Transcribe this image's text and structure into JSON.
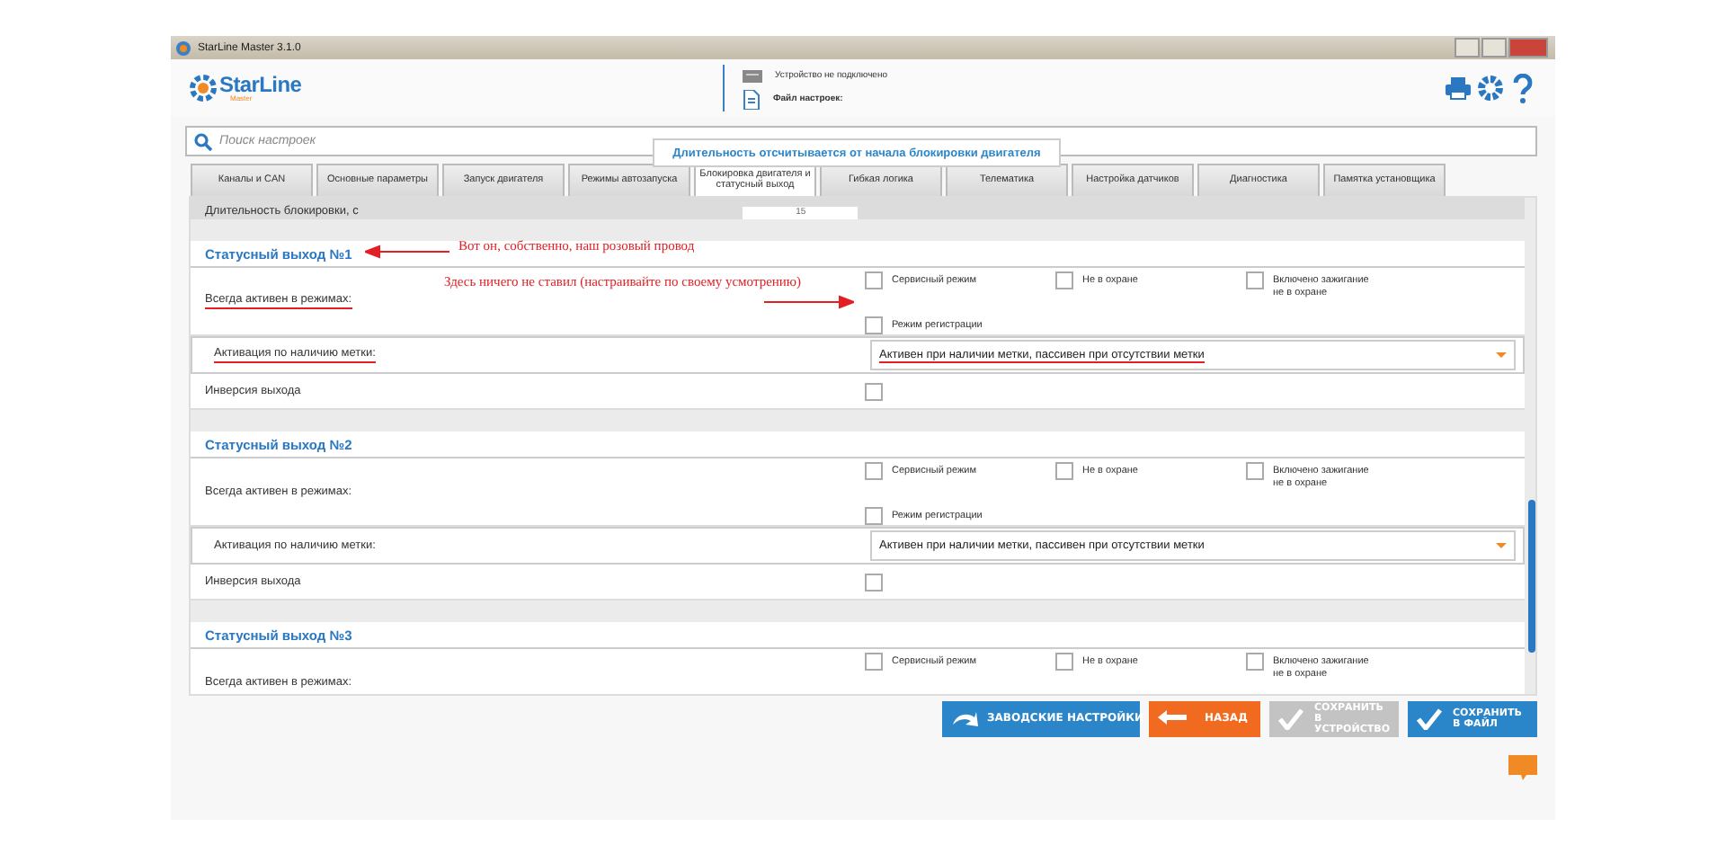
{
  "window": {
    "title": "StarLine Master 3.1.0"
  },
  "header": {
    "logo": {
      "name": "StarLine",
      "sub": "Master"
    },
    "device_status": "Устройство не подключено",
    "settings_file": "Файл настроек:"
  },
  "search": {
    "placeholder": "Поиск настроек"
  },
  "tooltip": "Длительность отсчитывается от начала блокировки двигателя",
  "tabs": [
    {
      "label": "Каналы и CAN",
      "selected": false
    },
    {
      "label": "Основные параметры",
      "selected": false
    },
    {
      "label": "Запуск двигателя",
      "selected": false
    },
    {
      "label": "Режимы автозапуска",
      "selected": false
    },
    {
      "label": "Блокировка двигателя и статусный выход",
      "selected": true
    },
    {
      "label": "Гибкая логика",
      "selected": false
    },
    {
      "label": "Телематика",
      "selected": false
    },
    {
      "label": "Настройка датчиков",
      "selected": false
    },
    {
      "label": "Диагностика",
      "selected": false
    },
    {
      "label": "Памятка установщика",
      "selected": false
    }
  ],
  "top_row": {
    "label": "Длительность блокировки, с",
    "value": "15"
  },
  "sections": [
    {
      "title": "Статусный выход №1",
      "rows": [
        {
          "kind": "checkboxes",
          "label": "Всегда активен в режимах:",
          "underlined": true,
          "options": [
            {
              "label": "Сервисный режим",
              "checked": false
            },
            {
              "label": "Не в охране",
              "checked": false
            },
            {
              "label": "Включено зажигание не в охране",
              "checked": false
            },
            {
              "label": "Режим регистрации",
              "checked": false
            }
          ]
        },
        {
          "kind": "select",
          "label": "Активация по наличию метки:",
          "underlined": true,
          "value": "Активен при наличии метки, пассивен при отсутствии метки",
          "value_underlined": true
        },
        {
          "kind": "checkbox",
          "label": "Инверсия выхода",
          "underlined": false,
          "checked": false
        }
      ]
    },
    {
      "title": "Статусный выход №2",
      "rows": [
        {
          "kind": "checkboxes",
          "label": "Всегда активен в режимах:",
          "underlined": false,
          "options": [
            {
              "label": "Сервисный режим",
              "checked": false
            },
            {
              "label": "Не в охране",
              "checked": false
            },
            {
              "label": "Включено зажигание не в охране",
              "checked": false
            },
            {
              "label": "Режим регистрации",
              "checked": false
            }
          ]
        },
        {
          "kind": "select",
          "label": "Активация по наличию метки:",
          "underlined": false,
          "value": "Активен при наличии метки, пассивен при отсутствии метки",
          "value_underlined": false
        },
        {
          "kind": "checkbox",
          "label": "Инверсия выхода",
          "underlined": false,
          "checked": false
        }
      ]
    },
    {
      "title": "Статусный выход №3",
      "rows": [
        {
          "kind": "checkboxes",
          "label": "Всегда активен в режимах:",
          "underlined": false,
          "options": [
            {
              "label": "Сервисный режим",
              "checked": false
            },
            {
              "label": "Не в охране",
              "checked": false
            },
            {
              "label": "Включено зажигание не в охране",
              "checked": false
            }
          ]
        }
      ]
    }
  ],
  "buttons": [
    {
      "kind": "reset",
      "label": "ЗАВОДСКИЕ НАСТРОЙКИ",
      "disabled": false
    },
    {
      "kind": "back",
      "label": "НАЗАД",
      "disabled": false
    },
    {
      "kind": "save",
      "label": "СОХРАНИТЬ В УСТРОЙСТВО",
      "disabled": true
    },
    {
      "kind": "save",
      "label": "СОХРАНИТЬ В ФАЙЛ",
      "disabled": false
    }
  ],
  "annotations": [
    {
      "text": "Вот он, собственно, наш розовый провод",
      "kind": "left_arrow"
    },
    {
      "text": "Здесь ничего не ставил (настраивайте по своему усмотрению)",
      "kind": "right_arrow"
    }
  ]
}
